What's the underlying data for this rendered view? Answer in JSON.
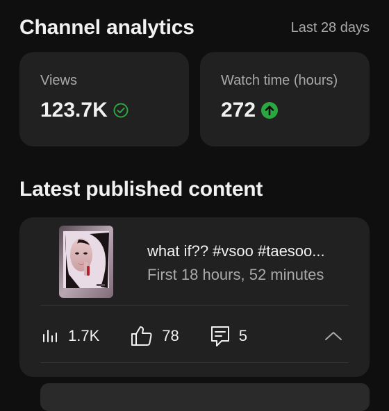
{
  "header": {
    "title": "Channel analytics",
    "range": "Last 28 days"
  },
  "cards": [
    {
      "label": "Views",
      "value": "123.7K",
      "icon": "check-circle-icon",
      "icon_color": "#2ba640"
    },
    {
      "label": "Watch time (hours)",
      "value": "272",
      "icon": "arrow-up-circle-icon",
      "icon_color": "#2ba640"
    }
  ],
  "latest": {
    "title": "Latest published content",
    "video": {
      "title": "what if?? #vsoo #taesoo...",
      "subtitle": "First 18 hours, 52 minutes",
      "views": "1.7K",
      "likes": "78",
      "comments": "5"
    }
  },
  "colors": {
    "background": "#0f0f0f",
    "card": "#212121",
    "accent_green": "#2ba640",
    "muted_text": "#aaaaaa"
  }
}
